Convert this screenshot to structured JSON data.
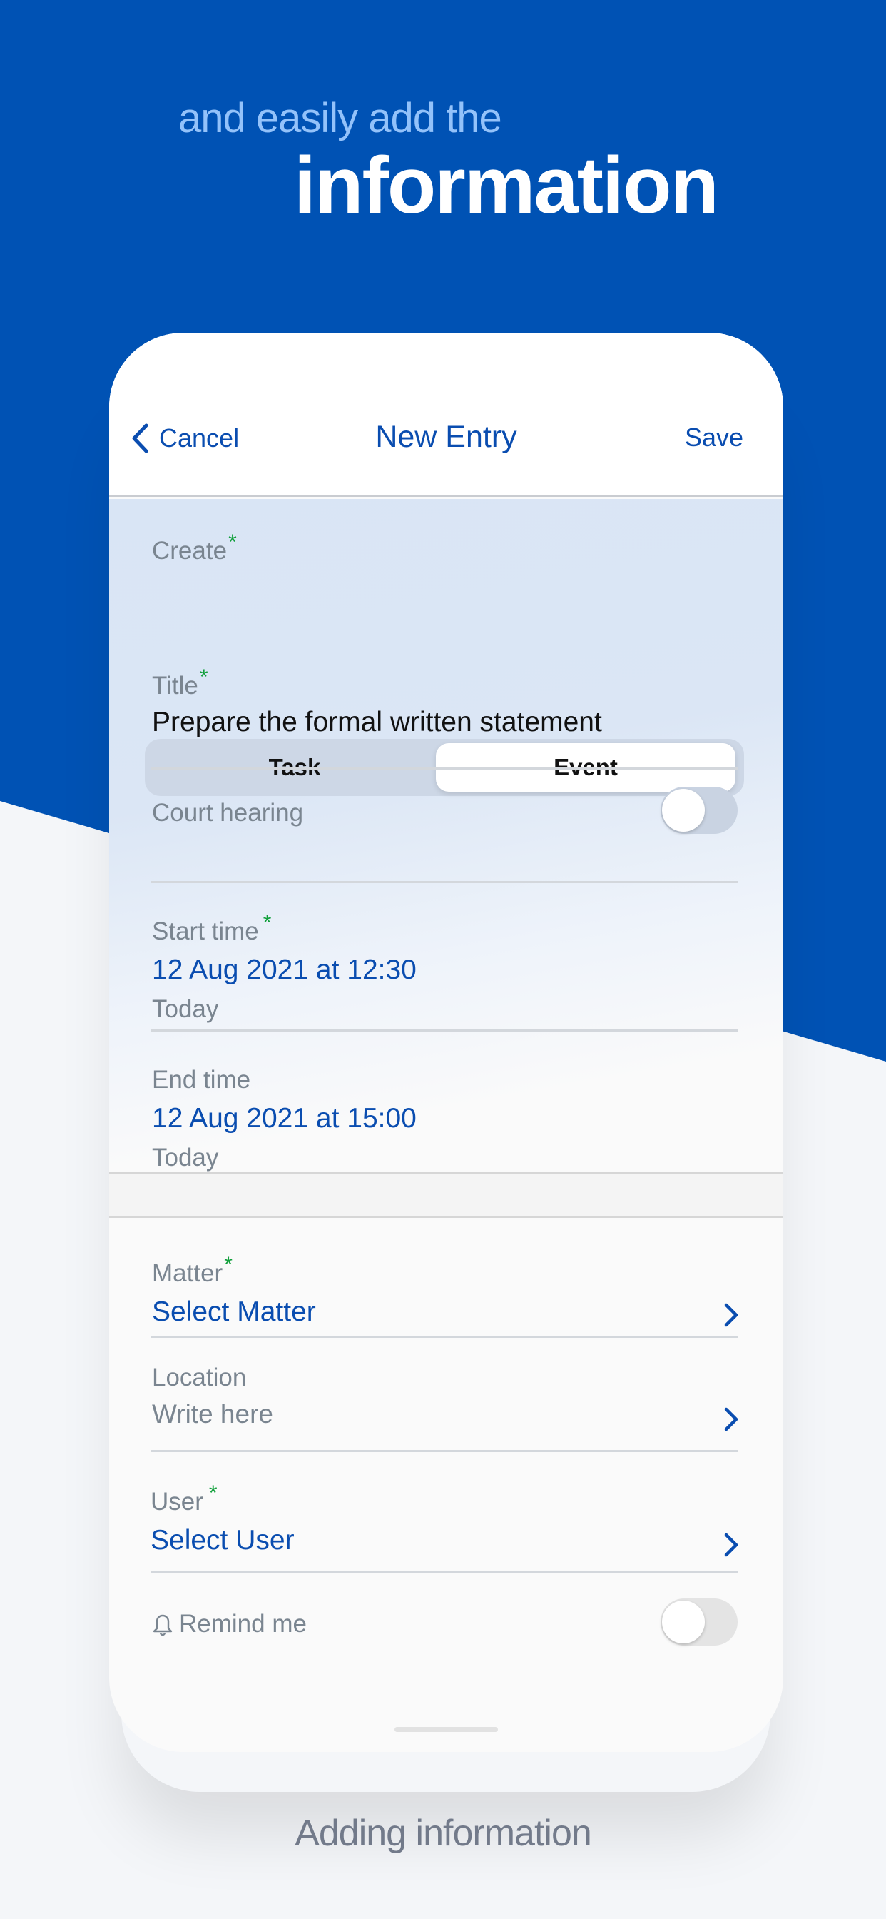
{
  "marketing": {
    "headline_sub": "and easily add the",
    "headline_main": "information",
    "caption": "Adding information"
  },
  "nav": {
    "cancel_label": "Cancel",
    "title": "New Entry",
    "save_label": "Save"
  },
  "form": {
    "create": {
      "label": "Create",
      "required_mark": "*",
      "options": [
        "Task",
        "Event"
      ],
      "selected": "Event"
    },
    "title": {
      "label": "Title",
      "required_mark": "*",
      "value": "Prepare the formal written statement"
    },
    "court_hearing": {
      "label": "Court hearing",
      "enabled": false
    },
    "start_time": {
      "label": "Start time",
      "required_mark": "*",
      "value": "12 Aug 2021 at 12:30",
      "relative": "Today"
    },
    "end_time": {
      "label": "End time",
      "value": "12 Aug 2021 at 15:00",
      "relative": "Today"
    },
    "matter": {
      "label": "Matter",
      "required_mark": "*",
      "value": "Select Matter"
    },
    "location": {
      "label": "Location",
      "placeholder": "Write here"
    },
    "user": {
      "label": "User",
      "required_mark": "*",
      "value": "Select User"
    },
    "remind_me": {
      "label": "Remind me",
      "icon": "bell-icon",
      "enabled": false
    }
  },
  "colors": {
    "brand_blue": "#0052b4",
    "link_blue": "#0a4db0",
    "required_green": "#12a03c",
    "headline_light": "#93c2fa"
  }
}
